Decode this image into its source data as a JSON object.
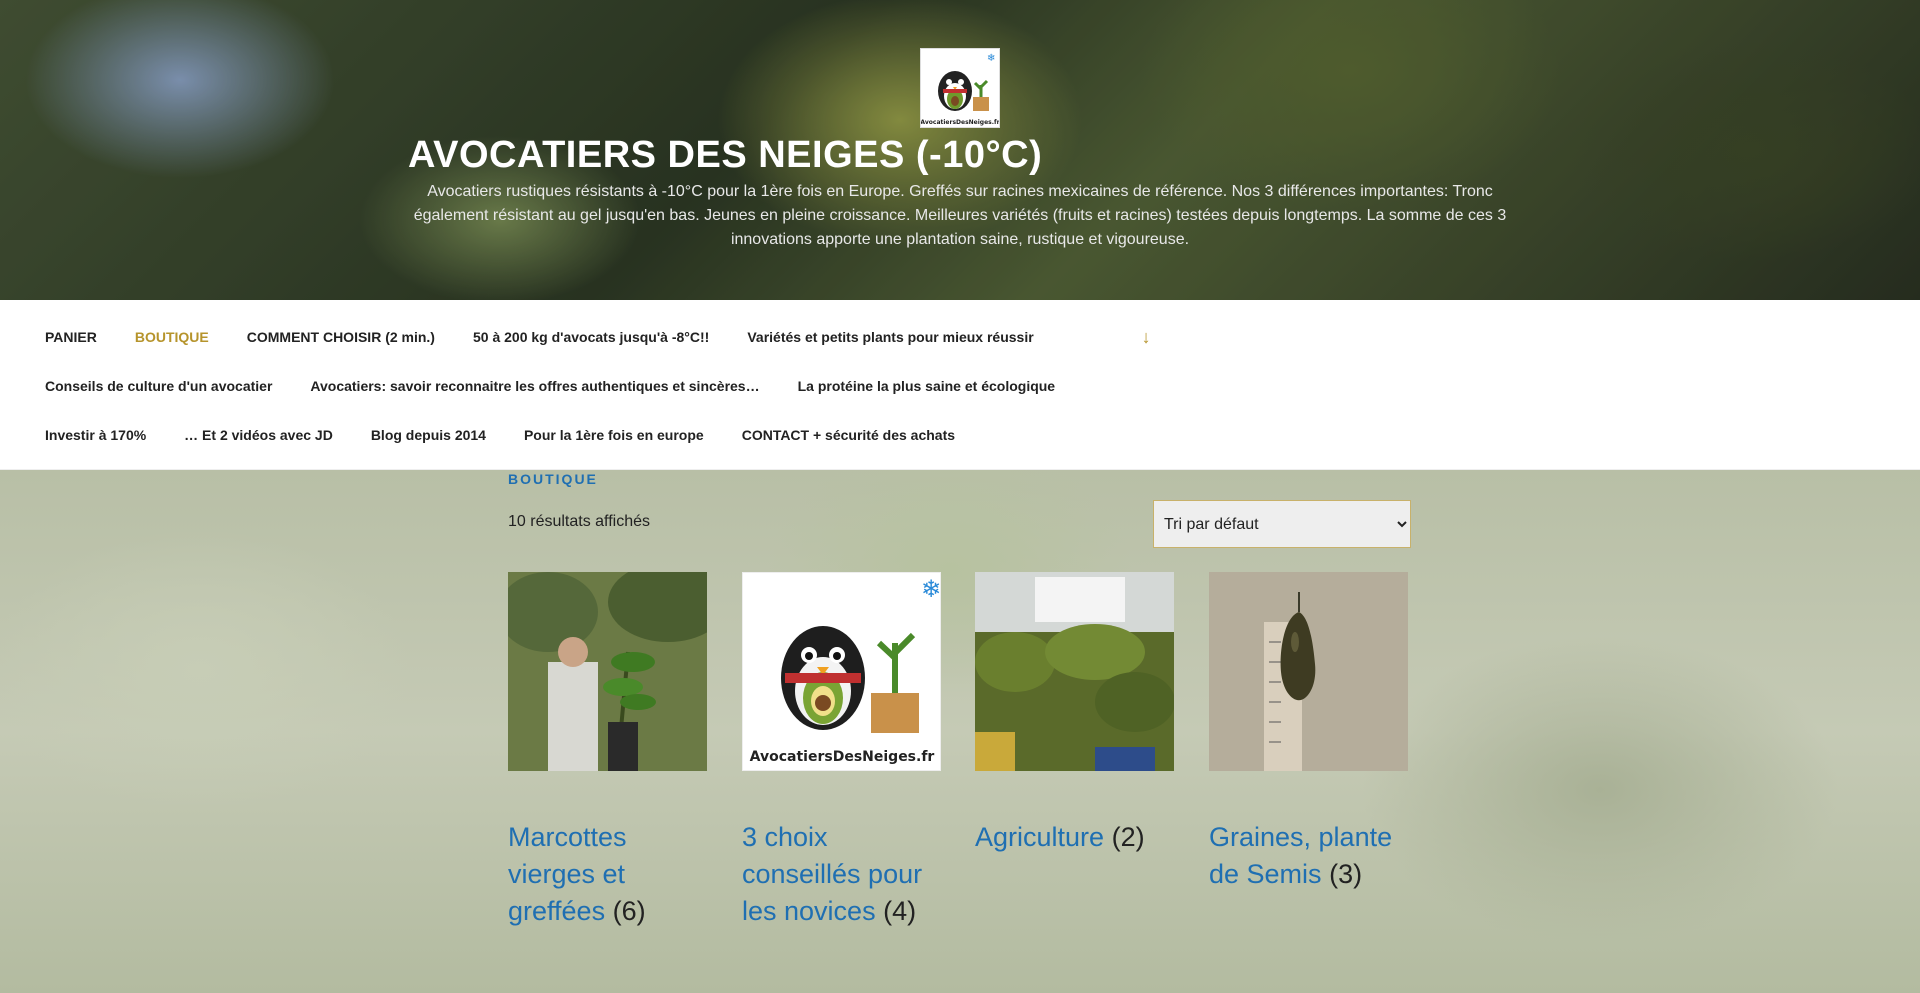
{
  "header": {
    "title": "AVOCATIERS DES NEIGES (-10°C)",
    "description": "Avocatiers rustiques résistants à -10°C pour la 1ère fois en Europe. Greffés sur racines mexicaines de référence. Nos 3 différences importantes: Tronc également résistant au gel jusqu'en bas. Jeunes en pleine croissance. Meilleures variétés (fruits et racines) testées depuis longtemps. La somme de ces 3 innovations apporte une plantation saine, rustique et vigoureuse.",
    "logo_icon": "penguin-avocado-logo-icon",
    "logo_text": "AvocatiersDesNeiges.fr"
  },
  "nav": {
    "row1": [
      "PANIER",
      "BOUTIQUE",
      "COMMENT CHOISIR (2 min.)",
      "50 à 200 kg d'avocats jusqu'à -8°C!!",
      "Variétés et petits plants pour mieux réussir"
    ],
    "row2": [
      "Conseils de culture d'un avocatier",
      "Avocatiers: savoir reconnaitre les offres authentiques et sincères…",
      "La protéine la plus saine et écologique"
    ],
    "row3": [
      "Investir à 170%",
      "… Et 2 vidéos avec JD",
      "Blog depuis 2014",
      "Pour la 1ère fois en europe",
      "CONTACT + sécurité des achats"
    ],
    "active_index": 1,
    "more_icon": "arrow-down-icon",
    "active_color": "#b6942c"
  },
  "shop": {
    "page_title": "BOUTIQUE",
    "result_count": "10 résultats affichés",
    "sort_selected": "Tri par défaut",
    "link_color": "#1f6fb2",
    "categories": [
      {
        "name": "Marcottes vierges et greffées",
        "count": "(6)",
        "image": "man-holding-plant"
      },
      {
        "name": "3 choix conseillés pour les novices",
        "count": "(4)",
        "image": "penguin-avocado-logo"
      },
      {
        "name": "Agriculture",
        "count": "(2)",
        "image": "nursery-plants"
      },
      {
        "name": "Graines, plante de Semis",
        "count": "(3)",
        "image": "avocado-with-ruler"
      }
    ]
  }
}
